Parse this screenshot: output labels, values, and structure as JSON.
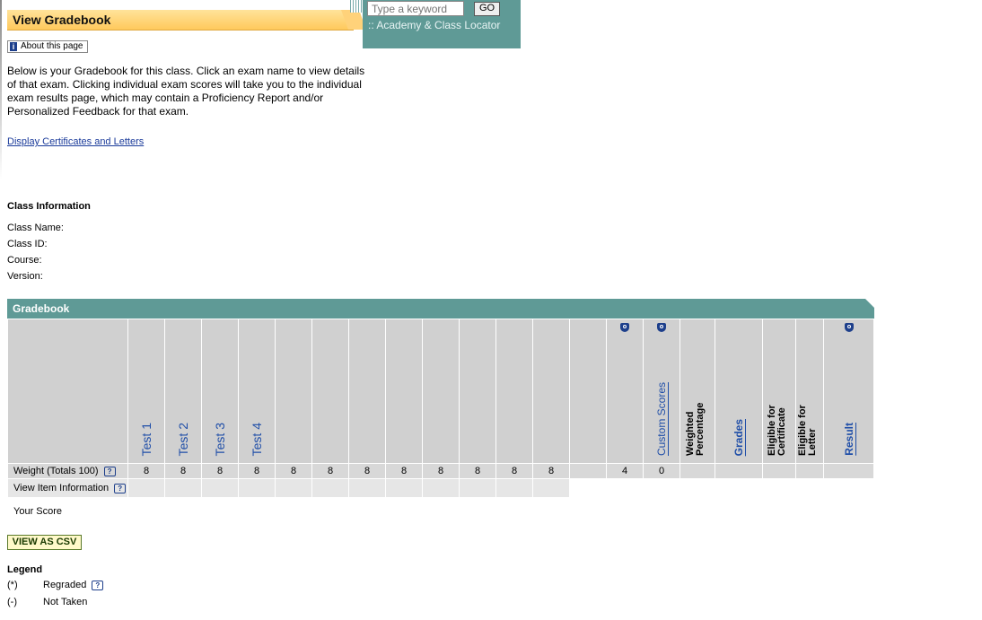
{
  "page": {
    "title": "View Gradebook",
    "about_label": "About this page"
  },
  "search": {
    "placeholder": "Type a keyword",
    "go_label": "GO",
    "locator_label": ":: Academy & Class Locator"
  },
  "intro_text": "Below is your Gradebook for this class. Click an exam name to view details of that exam. Clicking individual exam scores will take you to the individual exam results page, which may contain a Proficiency Report and/or Personalized Feedback for that exam.",
  "cert_link": "Display Certificates and Letters",
  "class_info": {
    "heading": "Class Information",
    "fields": [
      "Class Name:",
      "Class ID:",
      "Course:",
      "Version:"
    ]
  },
  "gradebook": {
    "title": "Gradebook",
    "columns": [
      {
        "label": "Test 1",
        "kind": "test"
      },
      {
        "label": "Test 2",
        "kind": "test"
      },
      {
        "label": "Test 3",
        "kind": "test"
      },
      {
        "label": "Test 4",
        "kind": "test"
      },
      {
        "label": "",
        "kind": "blank"
      },
      {
        "label": "",
        "kind": "blank"
      },
      {
        "label": "",
        "kind": "blank"
      },
      {
        "label": "",
        "kind": "blank"
      },
      {
        "label": "",
        "kind": "blank"
      },
      {
        "label": "",
        "kind": "blank"
      },
      {
        "label": "",
        "kind": "blank"
      },
      {
        "label": "",
        "kind": "blank"
      },
      {
        "label": "",
        "kind": "blank"
      },
      {
        "label": "",
        "kind": "blank",
        "icon": "shield-icon"
      },
      {
        "label": "Custom Scores",
        "kind": "link",
        "icon": "shield-icon"
      },
      {
        "label": "Weighted Percentage",
        "kind": "bold"
      },
      {
        "label": "Grades",
        "kind": "boldlink"
      },
      {
        "label": "Eligible for Certificate",
        "kind": "bold"
      },
      {
        "label": "Eligible for Letter",
        "kind": "bold"
      },
      {
        "label": "Result",
        "kind": "boldlink",
        "icon": "shield-icon"
      }
    ],
    "weight_label": "Weight (Totals 100)",
    "weights": [
      "8",
      "8",
      "8",
      "8",
      "8",
      "8",
      "8",
      "8",
      "8",
      "8",
      "8",
      "8",
      "",
      "4",
      "0",
      "",
      "",
      "",
      "",
      ""
    ],
    "info_label": "View Item Information",
    "score_label": "Your Score"
  },
  "csv_label": "VIEW AS CSV",
  "legend": {
    "title": "Legend",
    "items": [
      {
        "symbol": "(*)",
        "text": "Regraded"
      },
      {
        "symbol": "(-)",
        "text": "Not Taken"
      }
    ]
  }
}
